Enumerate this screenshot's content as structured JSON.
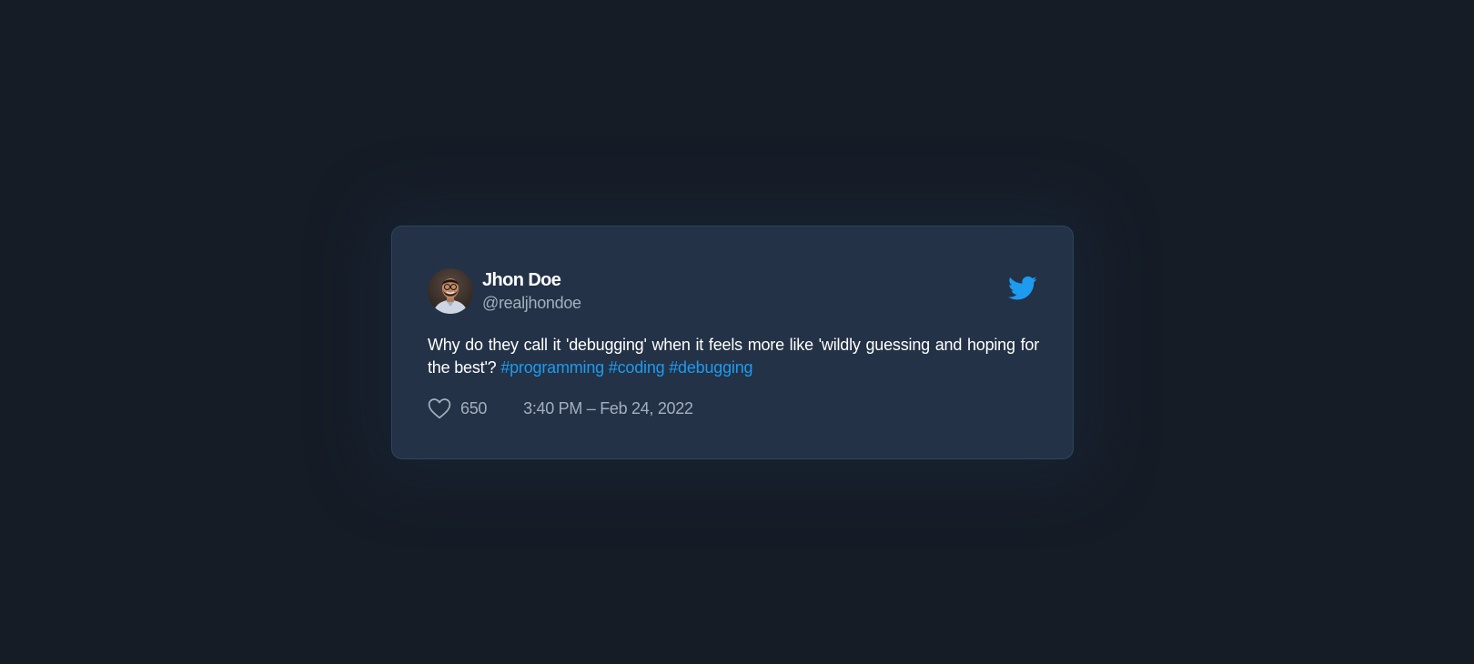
{
  "tweet": {
    "author": {
      "display_name": "Jhon Doe",
      "handle": "@realjhondoe",
      "avatar_icon": "profile-photo"
    },
    "brand_icon": "twitter-bird-icon",
    "text": "Why do they call it 'debugging' when it feels more like 'wildly guessing and hoping for the best'?",
    "hashtags": [
      "#programming",
      "#coding",
      "#debugging"
    ],
    "likes": "650",
    "like_icon": "heart-icon",
    "timestamp": "3:40 PM – Feb 24, 2022"
  },
  "colors": {
    "background": "#151c26",
    "card": "#233246",
    "card_border": "#30455f",
    "accent": "#1d9bf0",
    "text_primary": "#ffffff",
    "text_secondary": "#a3afbd"
  }
}
